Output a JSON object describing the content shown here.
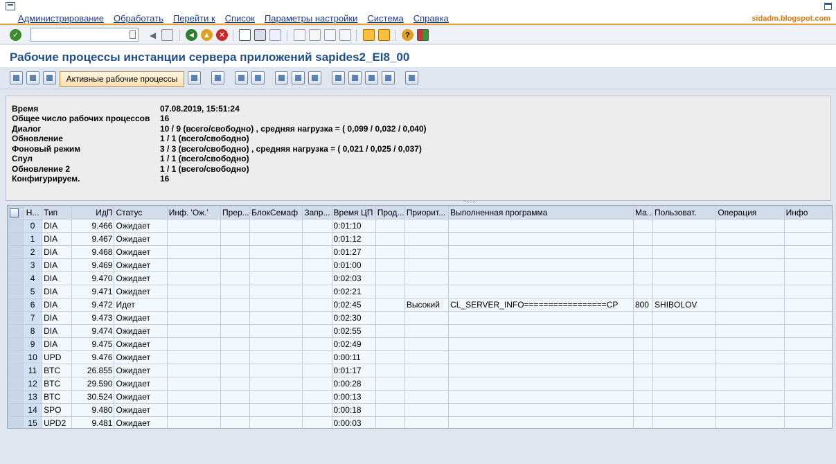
{
  "menubar": {
    "items": [
      "Администрирование",
      "Обработать",
      "Перейти к",
      "Список",
      "Параметры настройки",
      "Система",
      "Справка"
    ],
    "watermark": "sidadm.blogspot.com"
  },
  "toolbar": {
    "command_value": ""
  },
  "page": {
    "title": "Рабочие процессы инстанции сервера приложений sapides2_EI8_00"
  },
  "apptoolbar": {
    "active_button": "Активные рабочие процессы"
  },
  "info": {
    "rows": [
      {
        "label": "Время",
        "value": "07.08.2019, 15:51:24"
      },
      {
        "label": "Общее число рабочих процессов",
        "value": "16"
      },
      {
        "label": "Диалог",
        "value": "10 / 9 (всего/свободно) , средняя нагрузка = ( 0,099 / 0,032 / 0,040)"
      },
      {
        "label": "Обновление",
        "value": "1 / 1 (всего/свободно)"
      },
      {
        "label": "Фоновый режим",
        "value": "3 / 3 (всего/свободно) , средняя нагрузка = ( 0,021 / 0,025 / 0,037)"
      },
      {
        "label": "Спул",
        "value": "1 / 1 (всего/свободно)"
      },
      {
        "label": "Обновление 2",
        "value": "1 / 1 (всего/свободно)"
      },
      {
        "label": "Конфигурируем.",
        "value": "16"
      }
    ],
    "splitter": "....."
  },
  "grid": {
    "columns": [
      "Н...",
      "Тип",
      "ИдП",
      "Статус",
      "Инф. 'Ож.'",
      "Прер...",
      "БлокСемаф",
      "Запр...",
      "Время ЦП",
      "Прод...",
      "Приорит...",
      "Выполненная программа",
      "Ма...",
      "Пользоват.",
      "Операция",
      "Инфо"
    ],
    "rows": [
      [
        "0",
        "DIA",
        "9.466",
        "Ожидает",
        "",
        "",
        "",
        "",
        "0:01:10",
        "",
        "",
        "",
        "",
        "",
        "",
        ""
      ],
      [
        "1",
        "DIA",
        "9.467",
        "Ожидает",
        "",
        "",
        "",
        "",
        "0:01:12",
        "",
        "",
        "",
        "",
        "",
        "",
        ""
      ],
      [
        "2",
        "DIA",
        "9.468",
        "Ожидает",
        "",
        "",
        "",
        "",
        "0:01:27",
        "",
        "",
        "",
        "",
        "",
        "",
        ""
      ],
      [
        "3",
        "DIA",
        "9.469",
        "Ожидает",
        "",
        "",
        "",
        "",
        "0:01:00",
        "",
        "",
        "",
        "",
        "",
        "",
        ""
      ],
      [
        "4",
        "DIA",
        "9.470",
        "Ожидает",
        "",
        "",
        "",
        "",
        "0:02:03",
        "",
        "",
        "",
        "",
        "",
        "",
        ""
      ],
      [
        "5",
        "DIA",
        "9.471",
        "Ожидает",
        "",
        "",
        "",
        "",
        "0:02:21",
        "",
        "",
        "",
        "",
        "",
        "",
        ""
      ],
      [
        "6",
        "DIA",
        "9.472",
        "Идет",
        "",
        "",
        "",
        "",
        "0:02:45",
        "",
        "Высокий",
        "CL_SERVER_INFO=================CP",
        "800",
        "SHIBOLOV",
        "",
        ""
      ],
      [
        "7",
        "DIA",
        "9.473",
        "Ожидает",
        "",
        "",
        "",
        "",
        "0:02:30",
        "",
        "",
        "",
        "",
        "",
        "",
        ""
      ],
      [
        "8",
        "DIA",
        "9.474",
        "Ожидает",
        "",
        "",
        "",
        "",
        "0:02:55",
        "",
        "",
        "",
        "",
        "",
        "",
        ""
      ],
      [
        "9",
        "DIA",
        "9.475",
        "Ожидает",
        "",
        "",
        "",
        "",
        "0:02:49",
        "",
        "",
        "",
        "",
        "",
        "",
        ""
      ],
      [
        "10",
        "UPD",
        "9.476",
        "Ожидает",
        "",
        "",
        "",
        "",
        "0:00:11",
        "",
        "",
        "",
        "",
        "",
        "",
        ""
      ],
      [
        "11",
        "BTC",
        "26.855",
        "Ожидает",
        "",
        "",
        "",
        "",
        "0:01:17",
        "",
        "",
        "",
        "",
        "",
        "",
        ""
      ],
      [
        "12",
        "BTC",
        "29.590",
        "Ожидает",
        "",
        "",
        "",
        "",
        "0:00:28",
        "",
        "",
        "",
        "",
        "",
        "",
        ""
      ],
      [
        "13",
        "BTC",
        "30.524",
        "Ожидает",
        "",
        "",
        "",
        "",
        "0:00:13",
        "",
        "",
        "",
        "",
        "",
        "",
        ""
      ],
      [
        "14",
        "SPO",
        "9.480",
        "Ожидает",
        "",
        "",
        "",
        "",
        "0:00:18",
        "",
        "",
        "",
        "",
        "",
        "",
        ""
      ],
      [
        "15",
        "UPD2",
        "9.481",
        "Ожидает",
        "",
        "",
        "",
        "",
        "0:00:03",
        "",
        "",
        "",
        "",
        "",
        "",
        ""
      ]
    ]
  },
  "colors": {
    "accent_orange": "#e8a33d",
    "title_blue": "#1f4e8c",
    "menu_blue": "#1a3c8c"
  }
}
